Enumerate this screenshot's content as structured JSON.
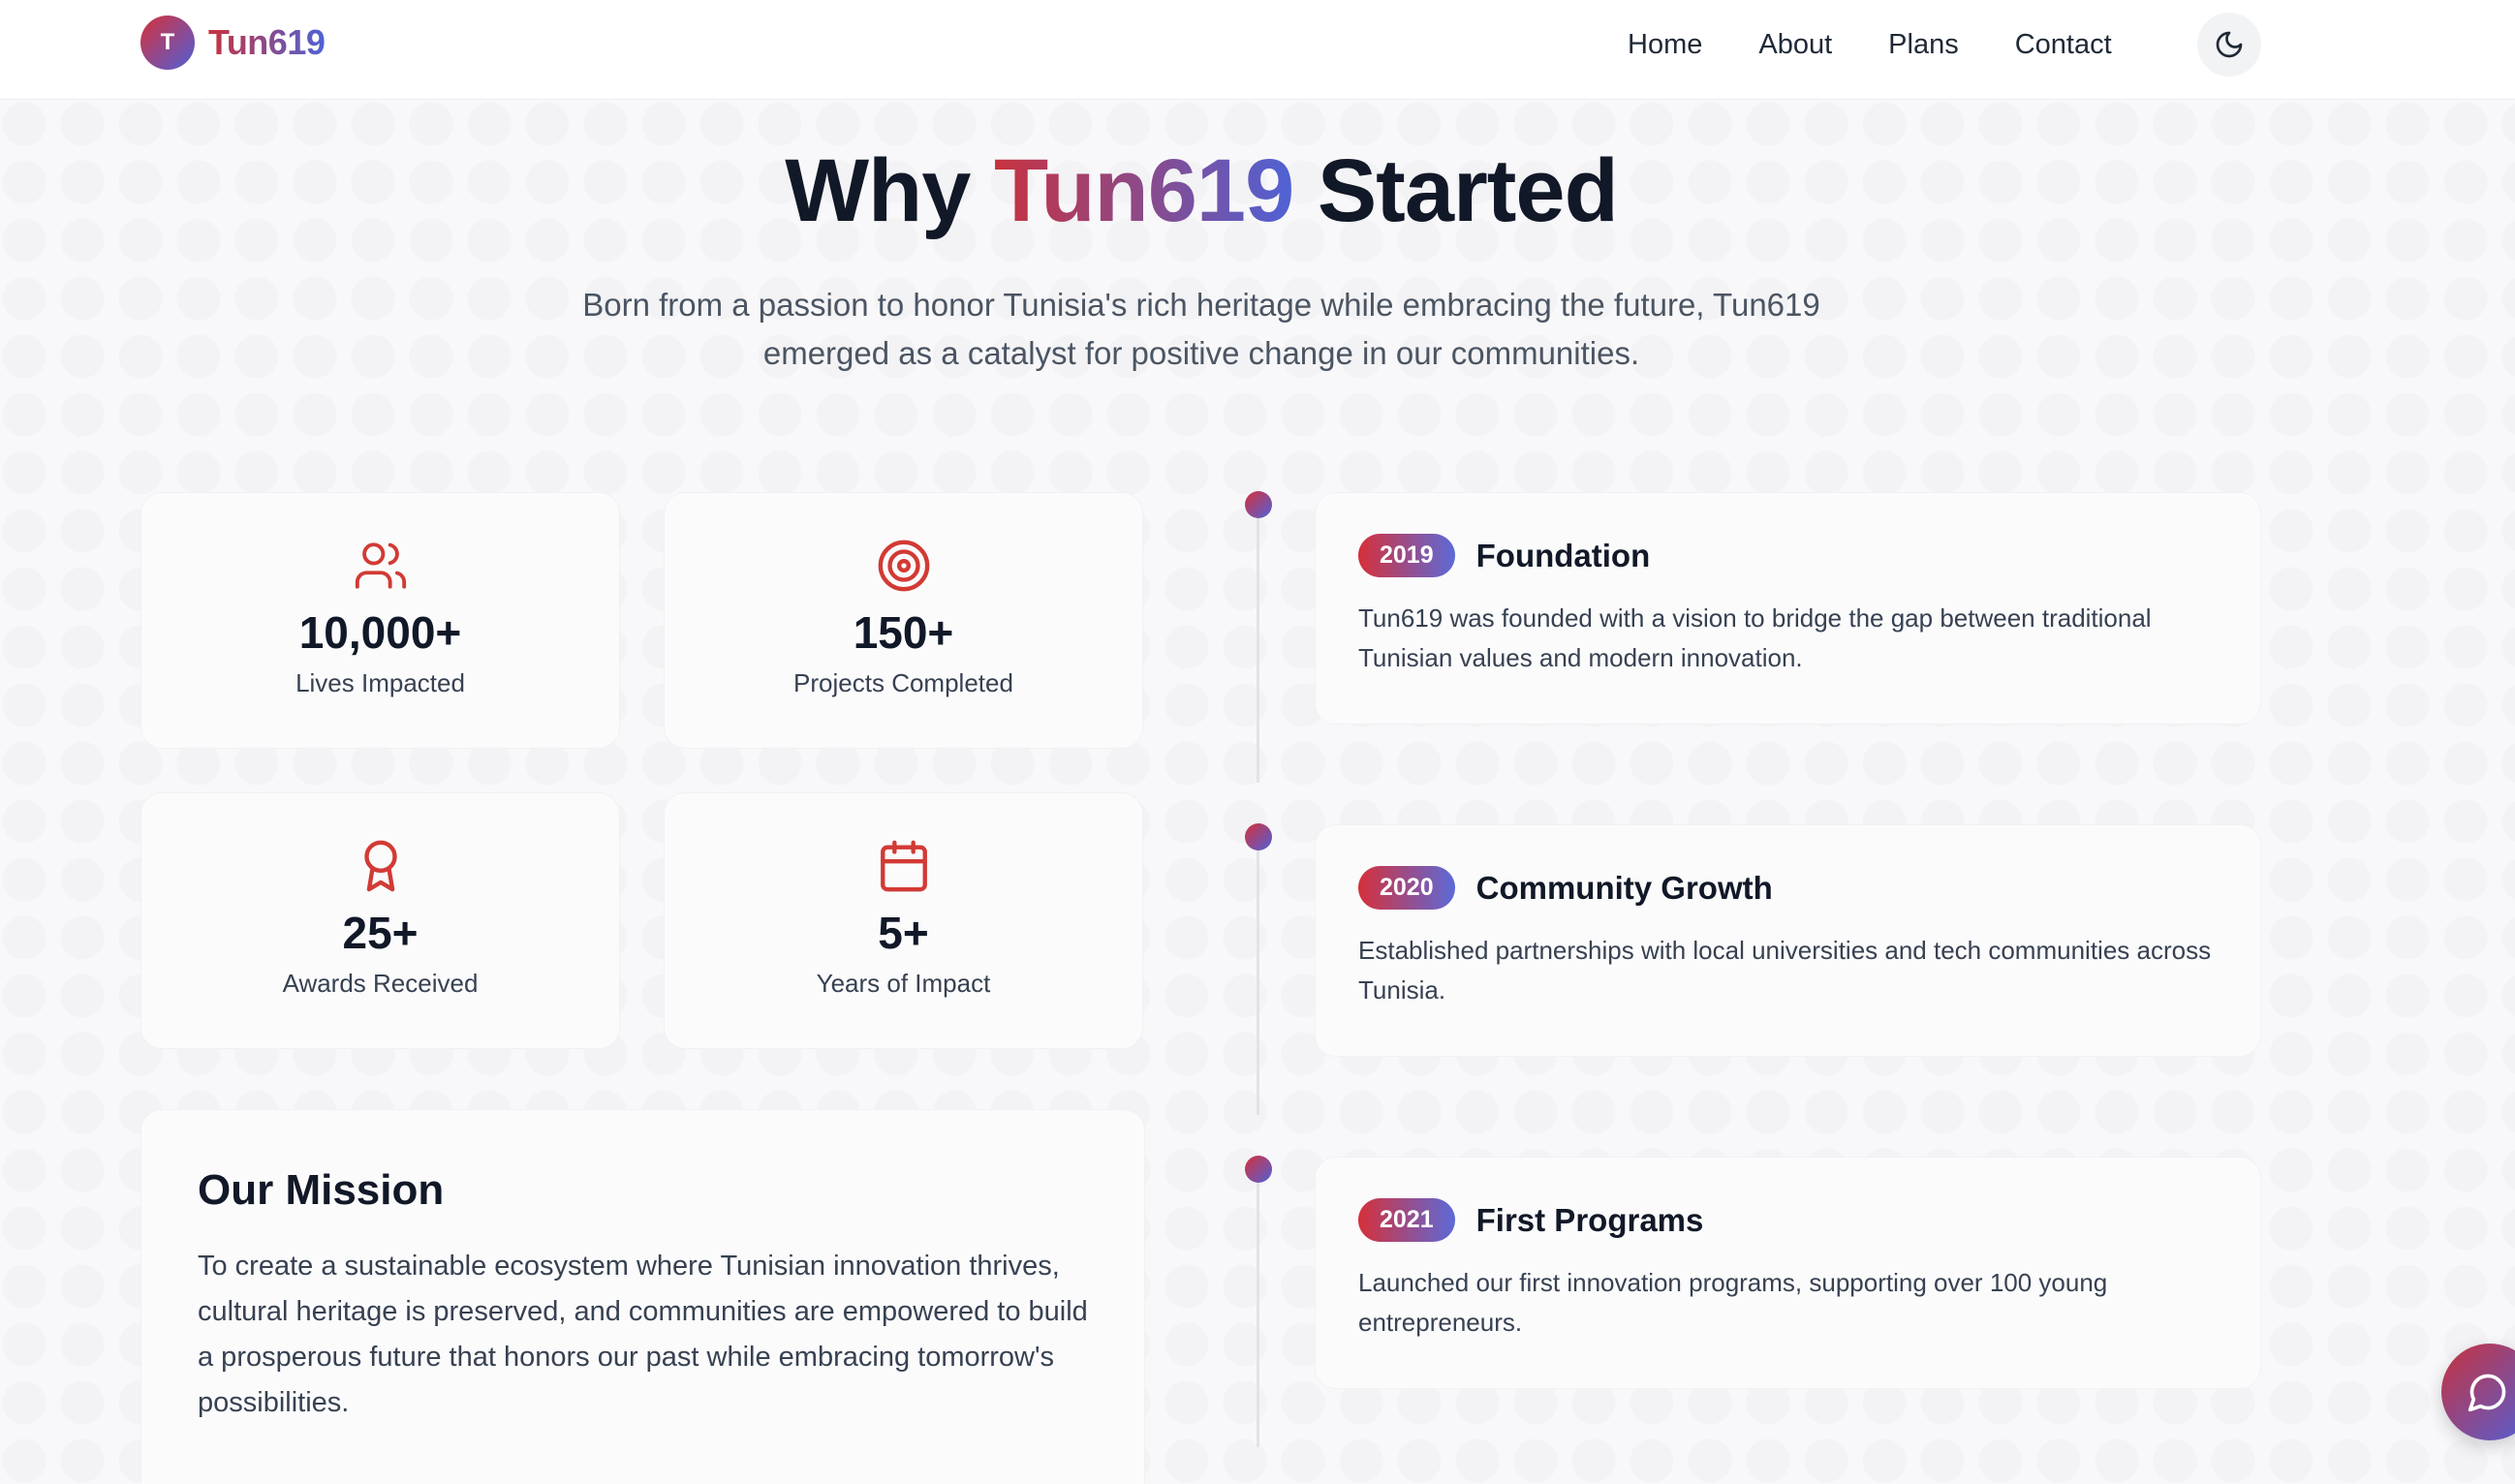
{
  "brand": {
    "logo_letter": "T",
    "name": "Tun619"
  },
  "nav": {
    "items": [
      "Home",
      "About",
      "Plans",
      "Contact"
    ]
  },
  "hero": {
    "title_prefix": "Why",
    "title_accent": "Tun619",
    "title_suffix": "Started",
    "subtitle": "Born from a passion to honor Tunisia's rich heritage while embracing the future, Tun619 emerged as a catalyst for positive change in our communities."
  },
  "stats": [
    {
      "icon": "users-icon",
      "value": "10,000+",
      "label": "Lives Impacted"
    },
    {
      "icon": "target-icon",
      "value": "150+",
      "label": "Projects Completed"
    },
    {
      "icon": "award-icon",
      "value": "25+",
      "label": "Awards Received"
    },
    {
      "icon": "calendar-icon",
      "value": "5+",
      "label": "Years of Impact"
    }
  ],
  "mission": {
    "title": "Our Mission",
    "text": "To create a sustainable ecosystem where Tunisian innovation thrives, cultural heritage is preserved, and communities are empowered to build a prosperous future that honors our past while embracing tomorrow's possibilities."
  },
  "timeline": [
    {
      "year": "2019",
      "title": "Foundation",
      "description": "Tun619 was founded with a vision to bridge the gap between traditional Tunisian values and modern innovation."
    },
    {
      "year": "2020",
      "title": "Community Growth",
      "description": "Established partnerships with local universities and tech communities across Tunisia."
    },
    {
      "year": "2021",
      "title": "First Programs",
      "description": "Launched our first innovation programs, supporting over 100 young entrepreneurs."
    }
  ],
  "colors": {
    "accent_red": "#c8323e",
    "accent_blue": "#4e62d6",
    "icon_red": "#d23a34"
  },
  "icons": {
    "theme_toggle": "moon-icon",
    "chat": "chat-bubble-icon"
  }
}
